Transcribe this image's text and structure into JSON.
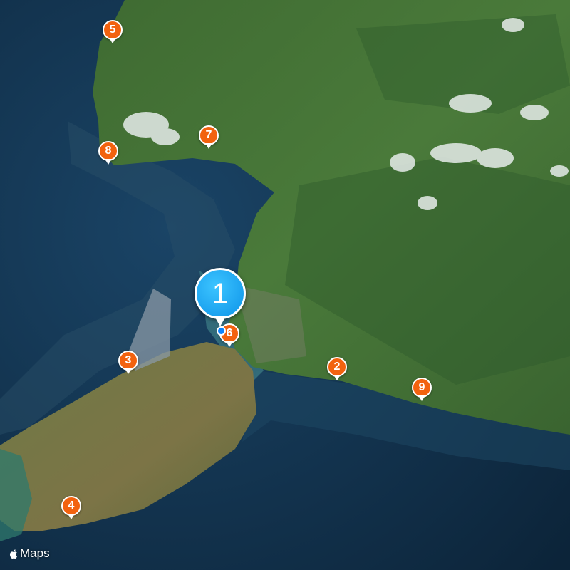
{
  "map": {
    "type": "satellite",
    "attribution": "Maps",
    "attribution_icon": "apple-logo-icon"
  },
  "primary_marker": {
    "label": "1",
    "color": "#0d93e8"
  },
  "markers": [
    {
      "id": "marker-2",
      "label": "2",
      "color": "#f2620f"
    },
    {
      "id": "marker-3",
      "label": "3",
      "color": "#f2620f"
    },
    {
      "id": "marker-4",
      "label": "4",
      "color": "#f2620f"
    },
    {
      "id": "marker-5",
      "label": "5",
      "color": "#f2620f"
    },
    {
      "id": "marker-6",
      "label": "6",
      "color": "#f2620f"
    },
    {
      "id": "marker-7",
      "label": "7",
      "color": "#f2620f"
    },
    {
      "id": "marker-8",
      "label": "8",
      "color": "#f2620f"
    },
    {
      "id": "marker-9",
      "label": "9",
      "color": "#f2620f"
    }
  ]
}
